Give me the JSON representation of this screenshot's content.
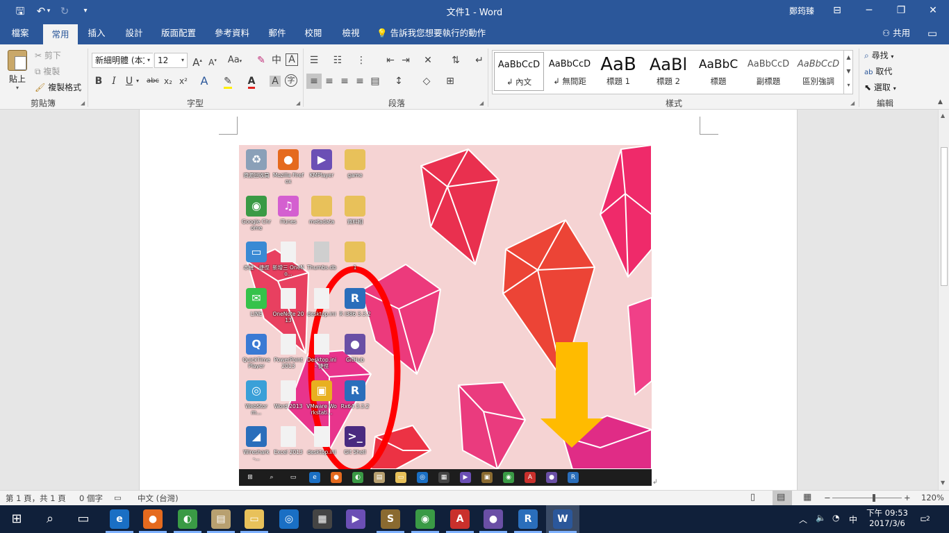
{
  "titlebar": {
    "title": "文件1  -  Word",
    "user": "鄭筠臻",
    "qat": {
      "save": "🖫",
      "undo": "↶",
      "undo_arrow": "▾",
      "redo": "↻",
      "customize": "▾"
    },
    "window_buttons": {
      "ribbon_options": "⊟",
      "minimize": "─",
      "restore": "❐",
      "close": "✕"
    }
  },
  "tabs": [
    "檔案",
    "常用",
    "插入",
    "設計",
    "版面配置",
    "參考資料",
    "郵件",
    "校閱",
    "檢視"
  ],
  "active_tab": "常用",
  "tell_me": "告訴我您想要執行的動作",
  "share": "共用",
  "ribbon": {
    "clipboard": {
      "label": "剪貼簿",
      "paste": "貼上",
      "cut": "剪下",
      "copy": "複製",
      "format_painter": "複製格式"
    },
    "font": {
      "label": "字型",
      "font_name": "新細明體 (本文",
      "font_size": "12",
      "grow": "A",
      "shrink": "A",
      "change_case": "Aa",
      "bold": "B",
      "italic": "I",
      "underline": "U",
      "strike": "abc",
      "subscript": "x₂",
      "superscript": "x²"
    },
    "paragraph": {
      "label": "段落"
    },
    "styles": {
      "label": "樣式",
      "items": [
        {
          "preview": "AaBbCcD",
          "name": "↲ 內文"
        },
        {
          "preview": "AaBbCcD",
          "name": "↲ 無間距"
        },
        {
          "preview": "AaB",
          "name": "標題 1"
        },
        {
          "preview": "AaBl",
          "name": "標題 2"
        },
        {
          "preview": "AaBbC",
          "name": "標題"
        },
        {
          "preview": "AaBbCcD",
          "name": "副標題"
        },
        {
          "preview": "AaBbCcD",
          "name": "區別強調"
        }
      ]
    },
    "editing": {
      "label": "編輯",
      "find": "尋找",
      "replace": "取代",
      "select": "選取"
    }
  },
  "desktop_icons": [
    {
      "label": "資源回收筒",
      "color": "#8aa0b8",
      "glyph": "♻"
    },
    {
      "label": "Mozilla Firefox",
      "color": "#e56a1e",
      "glyph": "●"
    },
    {
      "label": "KMPlayer",
      "color": "#6b4fb5",
      "glyph": "▶"
    },
    {
      "label": "game",
      "color": "#e8c15a",
      "glyph": ""
    },
    {
      "label": "Google Chrome",
      "color": "#3a9a45",
      "glyph": "◉"
    },
    {
      "label": "iTunes",
      "color": "#d45fd0",
      "glyph": "♫"
    },
    {
      "label": "metadata",
      "color": "#e8c15a",
      "glyph": ""
    },
    {
      "label": "資料相",
      "color": "#e8c15a",
      "glyph": ""
    },
    {
      "label": "本機 - 捷徑",
      "color": "#3a8ad4",
      "glyph": "▭"
    },
    {
      "label": "新增三 OneNo...",
      "color": "#f2f2f2",
      "glyph": ""
    },
    {
      "label": "Thumbs.db",
      "color": "#cfcfcf",
      "glyph": ""
    },
    {
      "label": "1",
      "color": "#e8c15a",
      "glyph": ""
    },
    {
      "label": "LINE",
      "color": "#35c24a",
      "glyph": "✉"
    },
    {
      "label": "OneNote 2013",
      "color": "#f2f2f2",
      "glyph": ""
    },
    {
      "label": "desktop.ini",
      "color": "#f2f2f2",
      "glyph": ""
    },
    {
      "label": "R i386 3.3.2",
      "color": "#2a6ebb",
      "glyph": "R"
    },
    {
      "label": "QuickTime Player",
      "color": "#3a7ad4",
      "glyph": "Q"
    },
    {
      "label": "PowerPoint 2013",
      "color": "#f2f2f2",
      "glyph": ""
    },
    {
      "label": "Desktop.ini - 捷徑",
      "color": "#f2f2f2",
      "glyph": ""
    },
    {
      "label": "GitHub",
      "color": "#6a4fa5",
      "glyph": "●"
    },
    {
      "label": "WebStorm...",
      "color": "#3aa0d8",
      "glyph": "◎"
    },
    {
      "label": "Word 2013",
      "color": "#f2f2f2",
      "glyph": ""
    },
    {
      "label": "VMware Workstati...",
      "color": "#e8b020",
      "glyph": "▣"
    },
    {
      "label": "Rx64 3.3.2",
      "color": "#2a6ebb",
      "glyph": "R"
    },
    {
      "label": "Wireshark -...",
      "color": "#2a6ebb",
      "glyph": "◢"
    },
    {
      "label": "Excel 2013",
      "color": "#f2f2f2",
      "glyph": ""
    },
    {
      "label": "desktop.ini",
      "color": "#f2f2f2",
      "glyph": ""
    },
    {
      "label": "Git Shell",
      "color": "#4a2a80",
      "glyph": ">_"
    }
  ],
  "mini_taskbar_icons": [
    {
      "color": "#1d1d1d",
      "glyph": "⊞"
    },
    {
      "color": "#1d1d1d",
      "glyph": "⌕"
    },
    {
      "color": "#1d1d1d",
      "glyph": "▭"
    },
    {
      "color": "#1a6fc4",
      "glyph": "e"
    },
    {
      "color": "#e56a1e",
      "glyph": "●"
    },
    {
      "color": "#3a9a45",
      "glyph": "◐"
    },
    {
      "color": "#b8a070",
      "glyph": "▤"
    },
    {
      "color": "#e8c15a",
      "glyph": "▭"
    },
    {
      "color": "#1a6fc4",
      "glyph": "◎"
    },
    {
      "color": "#444444",
      "glyph": "▦"
    },
    {
      "color": "#6b4fb5",
      "glyph": "▶"
    },
    {
      "color": "#8a6a30",
      "glyph": "▣"
    },
    {
      "color": "#3a9a45",
      "glyph": "◉"
    },
    {
      "color": "#c9302c",
      "glyph": "A"
    },
    {
      "color": "#6a4fa5",
      "glyph": "●"
    },
    {
      "color": "#2a6ebb",
      "glyph": "R"
    }
  ],
  "statusbar": {
    "page": "第 1 頁，共 1 頁",
    "words": "0 個字",
    "language": "中文 (台灣)",
    "zoom": "120%",
    "zoom_level": 0.6
  },
  "taskbar": {
    "apps": [
      {
        "name": "start",
        "glyph": "⊞",
        "color": "transparent"
      },
      {
        "name": "search",
        "glyph": "⌕",
        "color": "transparent"
      },
      {
        "name": "task-view",
        "glyph": "▭",
        "color": "transparent"
      },
      {
        "name": "edge",
        "glyph": "e",
        "color": "#1a6fc4"
      },
      {
        "name": "firefox",
        "glyph": "●",
        "color": "#e56a1e"
      },
      {
        "name": "chrome-canary",
        "glyph": "◐",
        "color": "#3a9a45"
      },
      {
        "name": "notepad",
        "glyph": "▤",
        "color": "#b8a070"
      },
      {
        "name": "file-explorer",
        "glyph": "▭",
        "color": "#e8c15a"
      },
      {
        "name": "browser",
        "glyph": "◎",
        "color": "#1a6fc4"
      },
      {
        "name": "store",
        "glyph": "▦",
        "color": "#444"
      },
      {
        "name": "visual-studio",
        "glyph": "▶",
        "color": "#6b4fb5"
      },
      {
        "name": "sublime",
        "glyph": "S",
        "color": "#8a6a30"
      },
      {
        "name": "chrome",
        "glyph": "◉",
        "color": "#3a9a45"
      },
      {
        "name": "access",
        "glyph": "A",
        "color": "#c9302c"
      },
      {
        "name": "github",
        "glyph": "●",
        "color": "#6a4fa5"
      },
      {
        "name": "r",
        "glyph": "R",
        "color": "#2a6ebb"
      },
      {
        "name": "word",
        "glyph": "W",
        "color": "#2b579a"
      }
    ],
    "ime": "中",
    "time": "下午 09:53",
    "date": "2017/3/6",
    "notification_count": "2"
  },
  "colors": {
    "word_blue": "#2b579a",
    "annotation_red": "#ff0000",
    "arrow_yellow": "#ffbb00"
  }
}
